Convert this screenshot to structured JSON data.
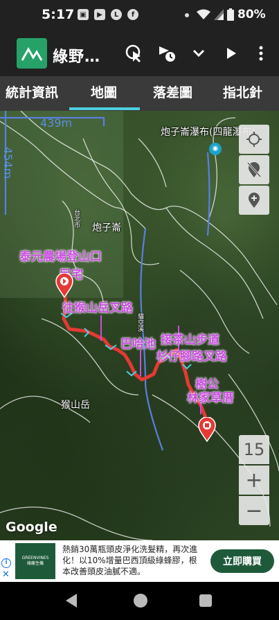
{
  "status": {
    "time": "5:17",
    "left_icons": [
      "image-icon",
      "youtube-icon",
      "line-icon",
      "facebook-icon"
    ],
    "right_icons": [
      "wifi-icon",
      "signal-icon",
      "battery-icon"
    ],
    "battery": "80%"
  },
  "appbar": {
    "title": "綠野…",
    "actions": [
      "touch-icon",
      "timer-icon",
      "chevron-down-icon",
      "play-icon",
      "more-vert-icon"
    ]
  },
  "tabs": {
    "items": [
      "統計資訊",
      "地圖",
      "落差圖",
      "指北針"
    ],
    "selected": 1,
    "indicator_color": "#4dd0e1"
  },
  "map": {
    "scale_horizontal": "439m",
    "scale_vertical": "454m",
    "place_labels": {
      "waterfall": "炮子崙瀑布(四龍瀑布)",
      "paozilun": "炮子崙",
      "houshanyue": "猴山岳",
      "road": "台北市",
      "stream": "貓空溪"
    },
    "poi_labels": {
      "trailhead_line1": "泰元農場登山口",
      "trailhead_line2": "民宅",
      "junction_hsy": "往猴山岳叉路",
      "bahachi": "巴哈池",
      "chaduxi_line1": "接茶山步道",
      "chaduxi_line2": "杉仔腳路叉路",
      "shugong_line1": "樹公",
      "shugong_line2": "林家草厝"
    },
    "track_color": "#e53935",
    "zoom_level": "15",
    "zoom_in": "+",
    "zoom_out": "−",
    "attribution": "Google",
    "controls": [
      "my-location-icon",
      "location-off-icon",
      "add-location-icon"
    ]
  },
  "ad": {
    "brand_line1": "GREENVINES",
    "brand_line2": "綠藤生機",
    "text": "熱銷30萬瓶頭皮淨化洗髮精，再次進化！以10%增量巴西頂級綠蜂膠，根本改善頭皮油膩不適。",
    "button": "立即購買",
    "accent": "#1e5a3a"
  }
}
